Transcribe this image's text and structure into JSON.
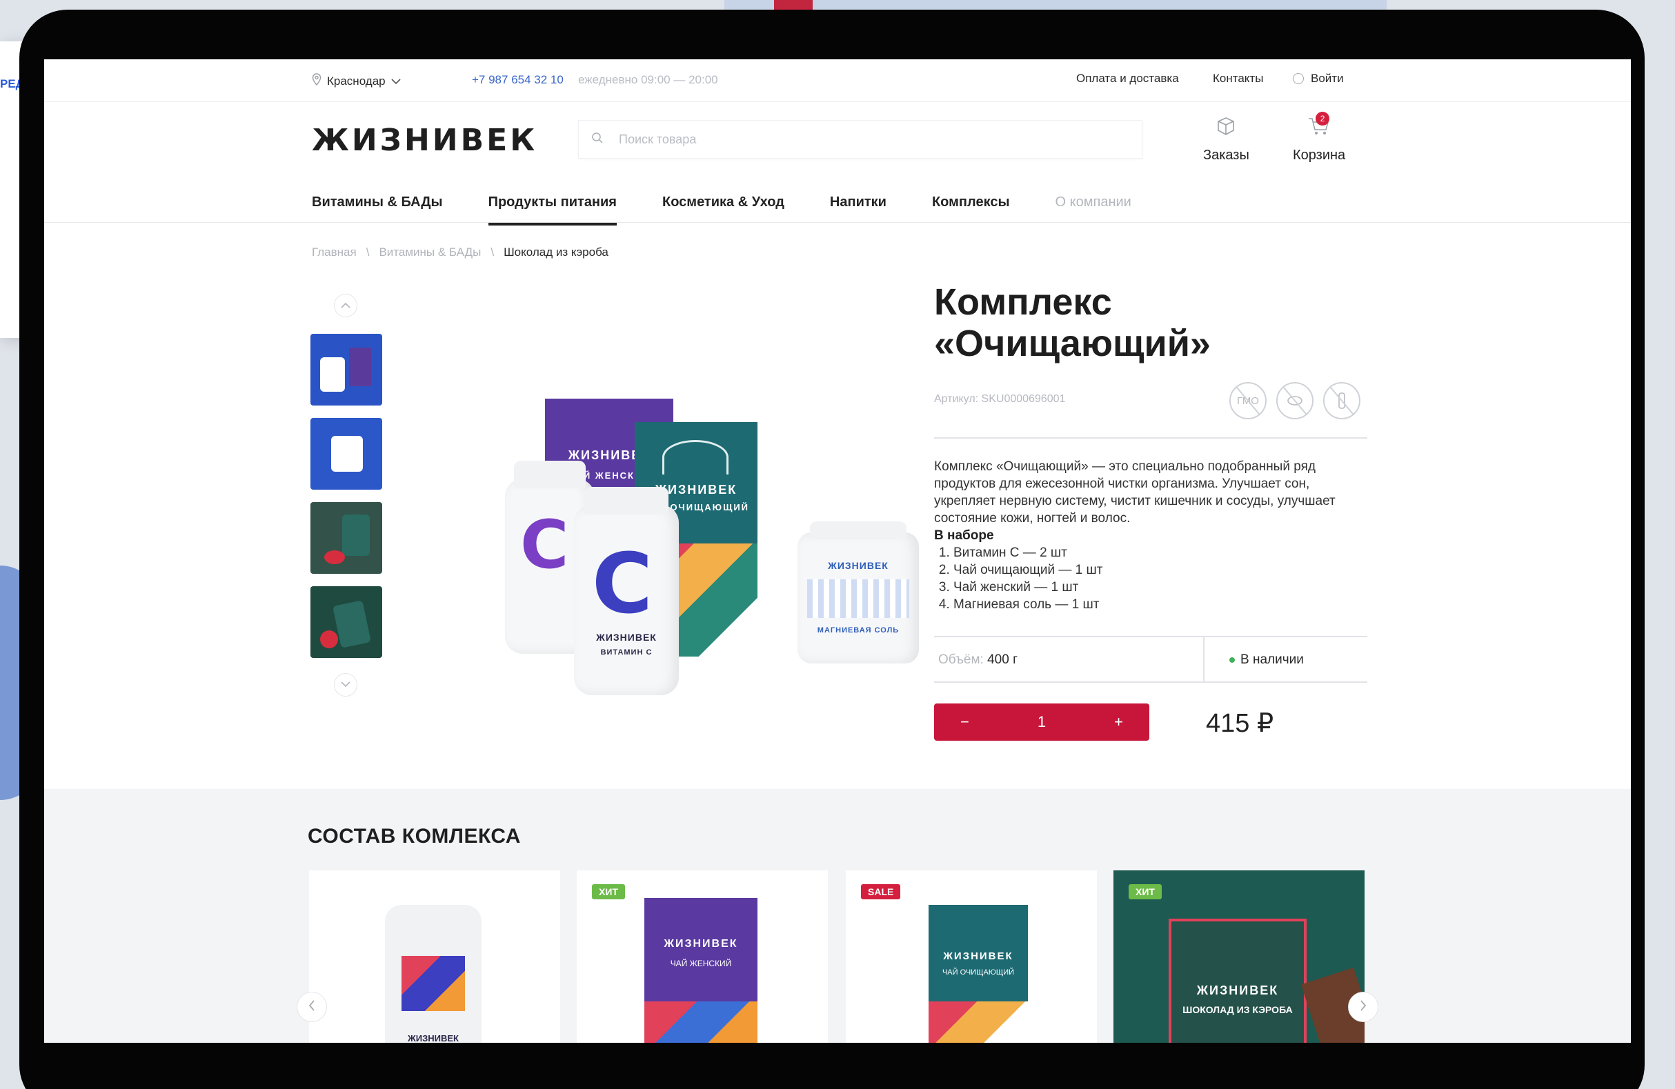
{
  "topbar": {
    "city": "Краснодар",
    "phone": "+7 987 654 32 10",
    "hours": "ежедневно 09:00 — 20:00",
    "payment_link": "Оплата и доставка",
    "contacts_link": "Контакты",
    "login_label": "Войти"
  },
  "header": {
    "logo": "ЖИЗНИВЕК",
    "search_placeholder": "Поиск товара",
    "orders_label": "Заказы",
    "cart_label": "Корзина",
    "cart_count": "2"
  },
  "nav": {
    "tabs": [
      {
        "label": "Витамины & БАДы"
      },
      {
        "label": "Продукты питания",
        "active": true
      },
      {
        "label": "Косметика & Уход"
      },
      {
        "label": "Напитки"
      },
      {
        "label": "Комплексы"
      },
      {
        "label": "О компании"
      }
    ]
  },
  "breadcrumb": {
    "items": [
      "Главная",
      "Витамины & БАДы",
      "Шоколад из кэроба"
    ],
    "separator": "\\"
  },
  "product": {
    "title_line1": "Комплекс",
    "title_line2": "«Очищающий»",
    "sku_label": "Артикул:",
    "sku_value": "SKU0000696001",
    "cert_gmo": "ГМО",
    "description": "Комплекс «Очищающий» — это специально подобранный ряд продуктов для ежесезонной чистки организма. Улучшает сон, укрепляет нервную систему, чистит кишечник и сосуды, улучшает состояние кожи, ногтей и волос.",
    "kit_title": "В наборе",
    "kit_items": [
      "Витамин С — 2 шт",
      "Чай очищающий — 1 шт",
      "Чай женский — 1 шт",
      "Магниевая соль — 1 шт"
    ],
    "volume_label": "Объём:",
    "volume_value": "400 г",
    "stock": "В наличии",
    "quantity": "1",
    "qty_minus": "−",
    "qty_plus": "+",
    "price": "415 ₽"
  },
  "hero": {
    "jar_letter": "C",
    "jar_brand": "ЖИЗНИВЕК",
    "jar_label": "ВИТАМИН С",
    "tea_women": "ЧАЙ ЖЕНСКИЙ",
    "tea_clean": "ЧАЙ ОЧИЩАЮЩИЙ",
    "salt_brand": "ЖИЗНИВЕК",
    "salt_label": "МАГНИЕВАЯ СОЛЬ"
  },
  "composition": {
    "title": "СОСТАВ КОМЛЕКСА",
    "cards": [
      {
        "tag": "",
        "brand": "ЖИЗНИВЕК",
        "name": ""
      },
      {
        "tag": "ХИТ",
        "brand": "ЖИЗНИВЕК",
        "name": "ЧАЙ ЖЕНСКИЙ"
      },
      {
        "tag": "SALE",
        "brand": "ЖИЗНИВЕК",
        "name": "ЧАЙ ОЧИЩАЮЩИЙ"
      },
      {
        "tag": "ХИТ",
        "brand": "ЖИЗНИВЕК",
        "name": "ШОКОЛАД ИЗ КЭРОБА"
      }
    ]
  },
  "colors": {
    "accent": "#c8163b",
    "link_blue": "#3a66c9",
    "in_stock": "#43b05c",
    "hit_tag": "#6cbb48",
    "sale_tag": "#d51f3e"
  }
}
